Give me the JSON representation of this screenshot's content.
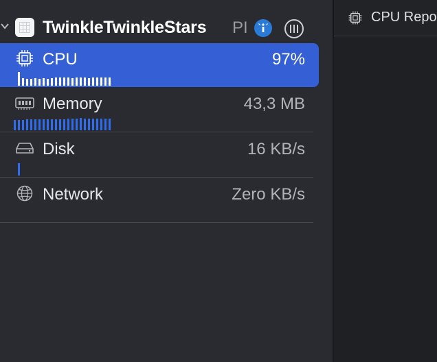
{
  "process": {
    "name": "TwinkleTwinkleStars",
    "pid_label": "PI"
  },
  "gauges": [
    {
      "label": "CPU",
      "value": "97%",
      "selected": true,
      "bars": [
        1,
        0.55,
        0.5,
        0.5,
        0.55,
        0.5,
        0.55,
        0.5,
        0.55,
        0.6,
        0.6,
        0.6,
        0.6,
        0.55,
        0.6,
        0.6,
        0.6,
        0.55,
        0.6,
        0.6,
        0.6,
        0.6,
        0.6
      ]
    },
    {
      "label": "Memory",
      "value": "43,3 MB",
      "selected": false,
      "bars": [
        0.75,
        0.75,
        0.75,
        0.8,
        0.8,
        0.8,
        0.8,
        0.8,
        0.8,
        0.8,
        0.8,
        0.8,
        0.8,
        0.85,
        0.85,
        0.85,
        0.9,
        0.85,
        0.85,
        0.85,
        0.85,
        0.85,
        0.85,
        0.85
      ]
    },
    {
      "label": "Disk",
      "value": "16 KB/s",
      "selected": false,
      "bars": [
        0.9
      ]
    },
    {
      "label": "Network",
      "value": "Zero KB/s",
      "selected": false,
      "bars": []
    }
  ],
  "editor": {
    "tab_label": "CPU Repo"
  },
  "icons": {
    "cpu": "chip-icon",
    "memory": "memory-icon",
    "disk": "disk-icon",
    "network": "globe-icon",
    "info": "info-icon",
    "pause": "pause-icon",
    "chevron": "chevron-down-icon"
  },
  "colors": {
    "selection": "#3560d5",
    "bar": "#2f6df0",
    "info_button": "#2a7bd8"
  }
}
